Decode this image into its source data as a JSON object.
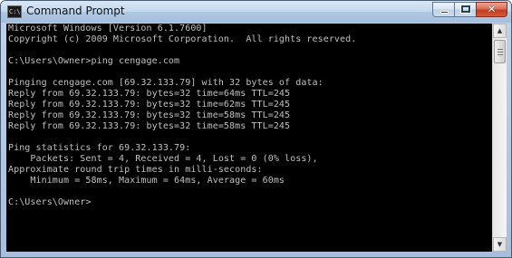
{
  "window": {
    "title": "Command Prompt",
    "icon": "cmd-icon",
    "controls": {
      "minimize": "minimize-icon",
      "maximize": "maximize-icon",
      "close": "close-icon"
    }
  },
  "console": {
    "background": "#000000",
    "foreground": "#c0c0c0",
    "lines": [
      "Microsoft Windows [Version 6.1.7600]",
      "Copyright (c) 2009 Microsoft Corporation.  All rights reserved.",
      "",
      "C:\\Users\\Owner>ping cengage.com",
      "",
      "Pinging cengage.com [69.32.133.79] with 32 bytes of data:",
      "Reply from 69.32.133.79: bytes=32 time=64ms TTL=245",
      "Reply from 69.32.133.79: bytes=32 time=62ms TTL=245",
      "Reply from 69.32.133.79: bytes=32 time=58ms TTL=245",
      "Reply from 69.32.133.79: bytes=32 time=58ms TTL=245",
      "",
      "Ping statistics for 69.32.133.79:",
      "    Packets: Sent = 4, Received = 4, Lost = 0 (0% loss),",
      "Approximate round trip times in milli-seconds:",
      "    Minimum = 58ms, Maximum = 64ms, Average = 60ms",
      "",
      "C:\\Users\\Owner>"
    ]
  },
  "scrollbar": {
    "up_icon": "scroll-up-arrow-icon",
    "down_icon": "scroll-down-arrow-icon"
  }
}
